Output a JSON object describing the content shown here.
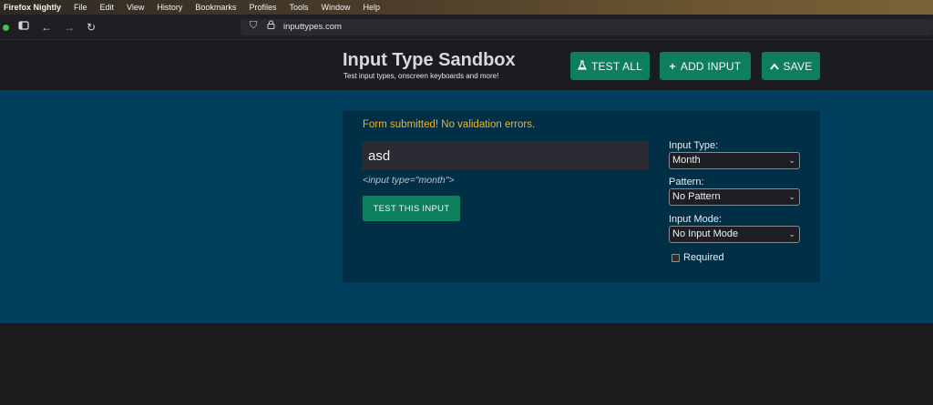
{
  "menubar": {
    "app": "Firefox Nightly",
    "items": [
      "File",
      "Edit",
      "View",
      "History",
      "Bookmarks",
      "Profiles",
      "Tools",
      "Window",
      "Help"
    ]
  },
  "browser": {
    "url": "inputtypes.com"
  },
  "header": {
    "title": "Input Type Sandbox",
    "subtitle": "Test input types, onscreen keyboards and more!",
    "test_all": "TEST ALL",
    "add_input": "ADD INPUT",
    "save": "SAVE"
  },
  "form": {
    "message": "Form submitted! No validation errors.",
    "input_value": "asd",
    "input_code": "<input type=\"month\">",
    "test_button": "TEST THIS INPUT",
    "input_type_label": "Input Type:",
    "input_type_value": "Month",
    "pattern_label": "Pattern:",
    "pattern_value": "No Pattern",
    "input_mode_label": "Input Mode:",
    "input_mode_value": "No Input Mode",
    "required_label": "Required",
    "required_checked": false
  },
  "colors": {
    "accent": "#0e7f5d",
    "band": "#003f5e",
    "panel": "#002f46",
    "message": "#f0b429"
  },
  "icons": [
    "sidebar-icon",
    "back-icon",
    "forward-icon",
    "reload-icon",
    "shield-icon",
    "lock-icon",
    "flask-icon",
    "plus-icon",
    "save-icon",
    "chevron-down-icon"
  ]
}
